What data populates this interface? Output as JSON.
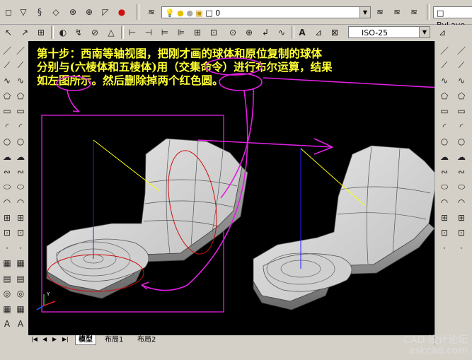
{
  "toolbar_top": {
    "layer_value": "0",
    "linetype_value": "ByLaye",
    "dimstyle_value": "ISO-25"
  },
  "canvas": {
    "instruction_lines": [
      "第十步：西南等轴视图，把刚才画的球体和原位复制的球体",
      "分别与(六棱体和五棱体)用（交集命令）进行布尔运算，结果",
      "如左图所示。然后删除掉两个红色圆。"
    ],
    "ucs_label": "Y"
  },
  "tabs": {
    "items": [
      {
        "label": "模型"
      },
      {
        "label": "布局1"
      },
      {
        "label": "布局2"
      }
    ]
  },
  "watermark": {
    "line1": "CAD 设计论坛",
    "line2": "askcad.com"
  },
  "colors": {
    "canvas_bg": "#000000",
    "text_yellow": "#ffff33",
    "annotation_magenta": "#e020e0",
    "circle_red": "#cc1010"
  },
  "icons": {
    "left_toolbar": [
      "line-icon",
      "xline-icon",
      "pline-icon",
      "polygon-icon",
      "rectangle-icon",
      "arc-icon",
      "circle-icon",
      "revcloud-icon",
      "spline-icon",
      "ellipse-icon",
      "ellipse-arc-icon",
      "insert-block-icon",
      "make-block-icon",
      "point-icon",
      "hatch-icon",
      "gradient-icon",
      "region-icon",
      "table-icon",
      "mtext-icon"
    ],
    "right_toolbar": [
      "box-icon",
      "sphere-icon",
      "cylinder-icon",
      "cone-icon",
      "wedge-icon",
      "torus-icon",
      "extrude-icon",
      "revolve-icon",
      "slice-icon",
      "section-icon",
      "interfere-icon",
      "union-icon",
      "subtract-icon",
      "intersect-icon"
    ]
  }
}
